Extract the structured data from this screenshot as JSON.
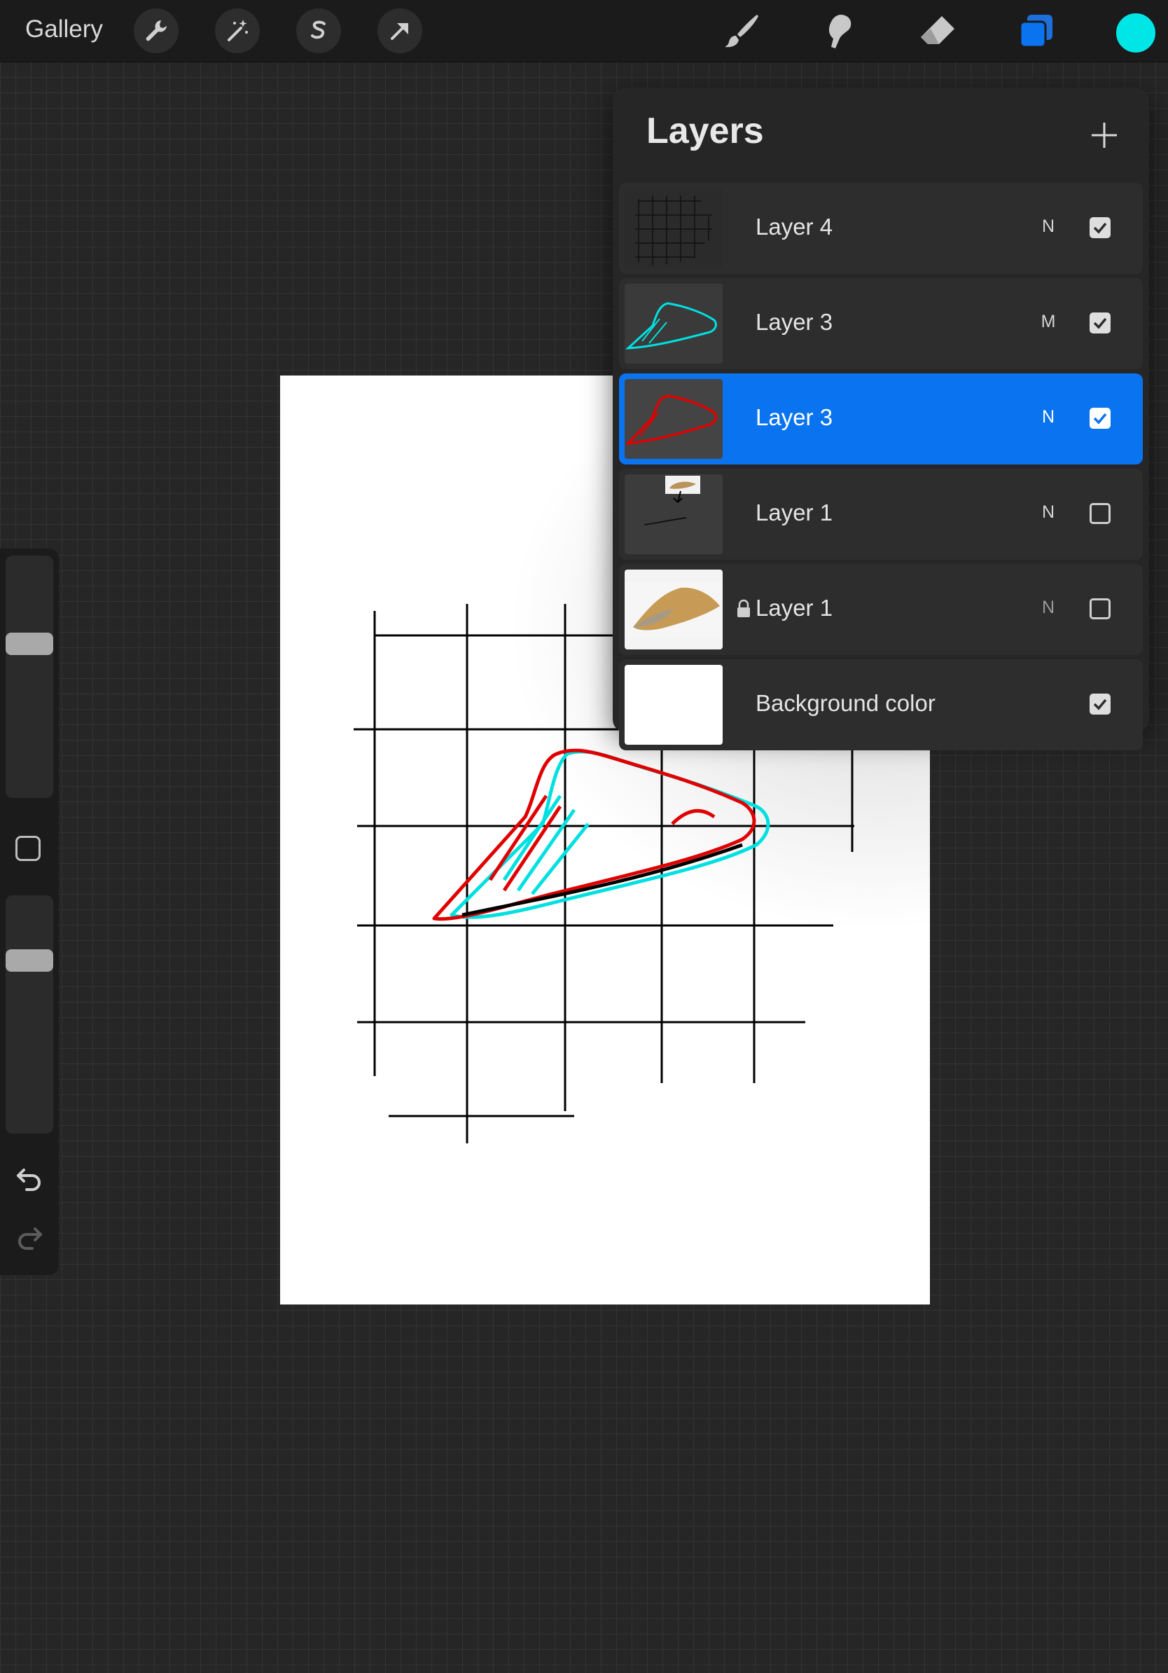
{
  "toolbar": {
    "gallery_label": "Gallery",
    "left_tools": [
      "wrench-icon",
      "magic-wand-icon",
      "selection-s-icon",
      "transform-arrow-icon"
    ],
    "right_tools": [
      "brush-icon",
      "smudge-icon",
      "eraser-icon",
      "layers-icon"
    ],
    "active_color": "#00e5e5",
    "accent_color": "#0a74f0"
  },
  "sidebar": {
    "brush_size_level": 0.35,
    "opacity_level": 0.25
  },
  "layers_panel": {
    "title": "Layers",
    "layers": [
      {
        "name": "Layer 4",
        "mode": "N",
        "visible": true,
        "selected": false,
        "locked": false
      },
      {
        "name": "Layer 3",
        "mode": "M",
        "visible": true,
        "selected": false,
        "locked": false
      },
      {
        "name": "Layer 3",
        "mode": "N",
        "visible": true,
        "selected": true,
        "locked": false
      },
      {
        "name": "Layer 1",
        "mode": "N",
        "visible": false,
        "selected": false,
        "locked": false
      },
      {
        "name": "Layer 1",
        "mode": "N",
        "visible": false,
        "selected": false,
        "locked": true
      },
      {
        "name": "Background color",
        "mode": "",
        "visible": true,
        "selected": false,
        "locked": false
      }
    ]
  }
}
